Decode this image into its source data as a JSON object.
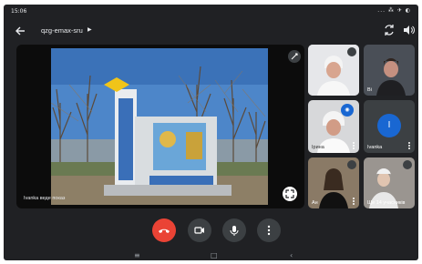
{
  "status_bar": {
    "time": "15:06",
    "icons_text": "... ⁂ ✈ ◐"
  },
  "top_bar": {
    "meeting_code": "qzg-emax-sru",
    "meeting_code_arrow": "▶"
  },
  "main_tile": {
    "caption": "Ivanka веде показ"
  },
  "tiles": [
    {
      "name": ""
    },
    {
      "name": "Ві"
    },
    {
      "name": "Ірина"
    },
    {
      "name": "Ivanka",
      "avatar_letter": "I"
    },
    {
      "name": "Ан"
    },
    {
      "name": "Ще 14 учасників"
    }
  ],
  "colors": {
    "end_call": "#ea4335",
    "avatar": "#1967d2",
    "screen_bg": "#202124",
    "tile_bg": "#3c4043"
  }
}
